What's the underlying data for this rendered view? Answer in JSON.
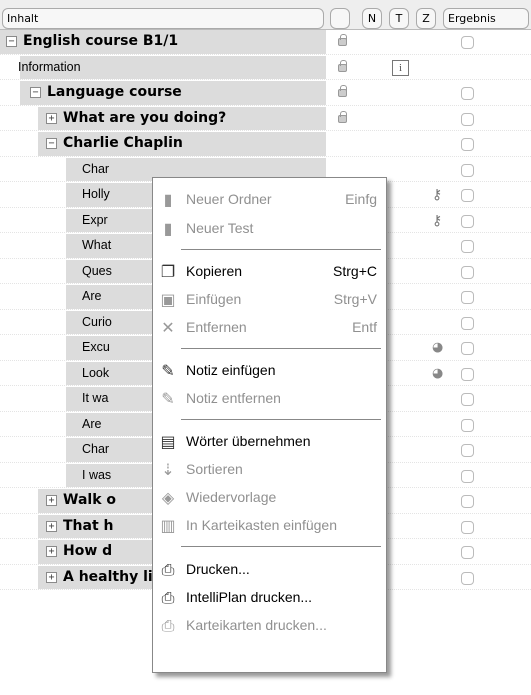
{
  "header": {
    "col_content": "Inhalt",
    "col_n": "N",
    "col_t": "T",
    "col_z": "Z",
    "col_result": "Ergebnis"
  },
  "tree": [
    {
      "label": "English course B1/1",
      "toggle": "−",
      "bold": true,
      "lock": true,
      "check": true
    },
    {
      "label": "Information",
      "lock": true,
      "info": "i"
    },
    {
      "label": "Language course",
      "toggle": "−",
      "bold": true,
      "lock": true,
      "check": true
    },
    {
      "label": "What are you doing?",
      "toggle": "+",
      "bold": true,
      "lock": true,
      "check": true
    },
    {
      "label": "Charlie Chaplin",
      "toggle": "−",
      "bold": true,
      "check": true
    },
    {
      "label": "Char",
      "check": true
    },
    {
      "label": "Holly",
      "check": true,
      "key": true
    },
    {
      "label": "Expr",
      "check": true,
      "key": true
    },
    {
      "label": "What",
      "check": true
    },
    {
      "label": "Ques",
      "check": true
    },
    {
      "label": "Are",
      "check": true
    },
    {
      "label": "Curio",
      "check": true
    },
    {
      "label": "Excu",
      "check": true,
      "dots": true
    },
    {
      "label": "Look",
      "check": true,
      "dots": true
    },
    {
      "label": "It wa",
      "check": true
    },
    {
      "label": "Are",
      "check": true
    },
    {
      "label": "Char",
      "check": true
    },
    {
      "label": "I was",
      "check": true
    },
    {
      "label": "Walk o",
      "toggle": "+",
      "bold": true,
      "check": true
    },
    {
      "label": "That h",
      "toggle": "+",
      "bold": true,
      "check": true
    },
    {
      "label": "How d",
      "toggle": "+",
      "bold": true,
      "check": true
    },
    {
      "label": "A healthy lifestyle",
      "toggle": "+",
      "bold": true,
      "lock": true,
      "check": true
    }
  ],
  "menu": {
    "new_folder": {
      "label": "Neuer Ordner",
      "shortcut": "Einfg"
    },
    "new_test": {
      "label": "Neuer Test"
    },
    "copy": {
      "label": "Kopieren",
      "shortcut": "Strg+C"
    },
    "paste": {
      "label": "Einfügen",
      "shortcut": "Strg+V"
    },
    "remove": {
      "label": "Entfernen",
      "shortcut": "Entf"
    },
    "add_note": {
      "label": "Notiz einfügen"
    },
    "remove_note": {
      "label": "Notiz entfernen"
    },
    "take_words": {
      "label": "Wörter übernehmen"
    },
    "sort": {
      "label": "Sortieren"
    },
    "resubmit": {
      "label": "Wiedervorlage"
    },
    "add_cardbox": {
      "label": "In Karteikasten einfügen"
    },
    "print": {
      "label": "Drucken..."
    },
    "print_intelliplan": {
      "label": "IntelliPlan drucken..."
    },
    "print_cards": {
      "label": "Karteikarten drucken..."
    }
  },
  "icons": {
    "new_folder": "folder-icon",
    "new_test": "test-icon",
    "copy": "copy-icon",
    "paste": "paste-icon",
    "remove": "delete-icon",
    "add_note": "note-icon",
    "remove_note": "note-remove-icon",
    "take_words": "words-icon",
    "sort": "sort-icon",
    "resubmit": "resubmit-icon",
    "add_cardbox": "cardbox-icon",
    "print": "printer-icon",
    "print_intelliplan": "printer-icon",
    "print_cards": "printer-icon"
  }
}
